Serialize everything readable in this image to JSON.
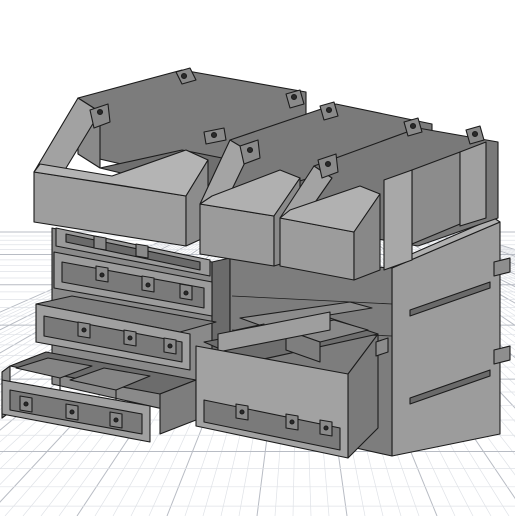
{
  "viewport": {
    "background_color": "#ffffff",
    "grid_major_color": "#b8bcc4",
    "grid_minor_color": "#dfe2e7",
    "model_light_color": "#9a9a9a",
    "model_mid_color": "#7f7f7f",
    "model_dark_color": "#5c5c5c",
    "edge_color": "#1c1c1c"
  },
  "model": {
    "top_bins": 3,
    "drawer_rows": 4,
    "open_drawers": 2,
    "side_cabinet_drawers": 1
  }
}
